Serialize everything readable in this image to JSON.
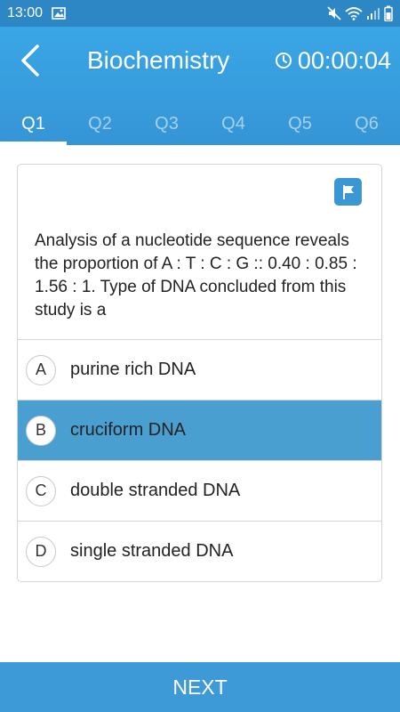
{
  "status_bar": {
    "time": "13:00",
    "icons": [
      "image-icon",
      "mute-icon",
      "wifi-icon",
      "signal-icon",
      "battery-icon"
    ]
  },
  "header": {
    "title": "Biochemistry",
    "timer": "00:00:04",
    "back_icon": "chevron-left-icon",
    "timer_icon": "clock-icon"
  },
  "tabs": [
    {
      "label": "Q1",
      "active": true
    },
    {
      "label": "Q2",
      "active": false
    },
    {
      "label": "Q3",
      "active": false
    },
    {
      "label": "Q4",
      "active": false
    },
    {
      "label": "Q5",
      "active": false
    },
    {
      "label": "Q6",
      "active": false
    }
  ],
  "question": {
    "text": "Analysis of a nucleotide sequence reveals the proportion of A : T : C : G :: 0.40 : 0.85 : 1.56 : 1. Type of DNA concluded from this study is a",
    "flag_icon": "flag-icon"
  },
  "options": [
    {
      "letter": "A",
      "text": "purine rich DNA",
      "selected": false
    },
    {
      "letter": "B",
      "text": "cruciform DNA",
      "selected": true
    },
    {
      "letter": "C",
      "text": "double stranded DNA",
      "selected": false
    },
    {
      "letter": "D",
      "text": "single stranded DNA",
      "selected": false
    }
  ],
  "footer": {
    "next_label": "NEXT"
  },
  "colors": {
    "header_blue": "#3aa6e6",
    "status_blue": "#2d87c4",
    "selected_option": "#4a9fd1",
    "next_button": "#3e9ad7",
    "flag_button": "#3b97d3"
  }
}
